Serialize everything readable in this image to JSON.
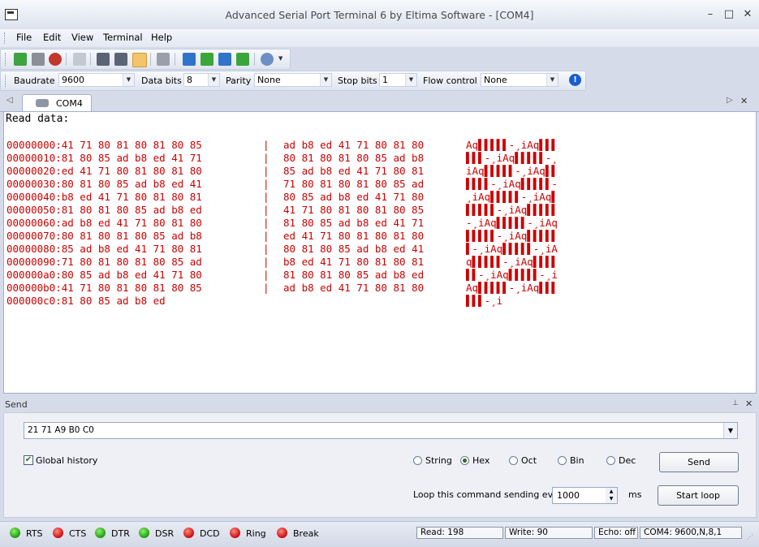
{
  "window": {
    "title": "Advanced Serial Port Terminal 6 by Eltima Software - [COM4]",
    "minimize": "–",
    "maximize": "□",
    "close": "✕"
  },
  "menu": [
    "File",
    "Edit",
    "View",
    "Terminal",
    "Help"
  ],
  "params": {
    "baudrate_label": "Baudrate",
    "baudrate_value": "9600",
    "databits_label": "Data bits",
    "databits_value": "8",
    "parity_label": "Parity",
    "parity_value": "None",
    "stopbits_label": "Stop bits",
    "stopbits_value": "1",
    "flow_label": "Flow control",
    "flow_value": "None"
  },
  "tab": {
    "label": "COM4",
    "close": "✕",
    "left_arrow": "◁",
    "right_arrow": "▷"
  },
  "terminal": {
    "header": "Read data:",
    "lines": [
      {
        "addr": "00000000:",
        "h1": "41 71 80 81 80 81 80 85",
        "h2": "ad b8 ed 41 71 80 81 80",
        "ascii": "Aq▌▌▌▌▌-¸iAq▌▌▌"
      },
      {
        "addr": "00000010:",
        "h1": "81 80 85 ad b8 ed 41 71",
        "h2": "80 81 80 81 80 85 ad b8",
        "ascii": "▌▌▌-¸iAq▌▌▌▌▌-¸"
      },
      {
        "addr": "00000020:",
        "h1": "ed 41 71 80 81 80 81 80",
        "h2": "85 ad b8 ed 41 71 80 81",
        "ascii": "iAq▌▌▌▌▌-¸iAq▌▌"
      },
      {
        "addr": "00000030:",
        "h1": "80 81 80 85 ad b8 ed 41",
        "h2": "71 80 81 80 81 80 85 ad",
        "ascii": "▌▌▌▌-¸iAq▌▌▌▌▌-"
      },
      {
        "addr": "00000040:",
        "h1": "b8 ed 41 71 80 81 80 81",
        "h2": "80 85 ad b8 ed 41 71 80",
        "ascii": "¸iAq▌▌▌▌▌-¸iAq▌"
      },
      {
        "addr": "00000050:",
        "h1": "81 80 81 80 85 ad b8 ed",
        "h2": "41 71 80 81 80 81 80 85",
        "ascii": "▌▌▌▌▌-¸iAq▌▌▌▌▌"
      },
      {
        "addr": "00000060:",
        "h1": "ad b8 ed 41 71 80 81 80",
        "h2": "81 80 85 ad b8 ed 41 71",
        "ascii": "-¸iAq▌▌▌▌▌-¸iAq"
      },
      {
        "addr": "00000070:",
        "h1": "80 81 80 81 80 85 ad b8",
        "h2": "ed 41 71 80 81 80 81 80",
        "ascii": "▌▌▌▌▌-¸iAq▌▌▌▌▌"
      },
      {
        "addr": "00000080:",
        "h1": "85 ad b8 ed 41 71 80 81",
        "h2": "80 81 80 85 ad b8 ed 41",
        "ascii": "▌-¸iAq▌▌▌▌▌-¸iA"
      },
      {
        "addr": "00000090:",
        "h1": "71 80 81 80 81 80 85 ad",
        "h2": "b8 ed 41 71 80 81 80 81",
        "ascii": "q▌▌▌▌▌-¸iAq▌▌▌▌"
      },
      {
        "addr": "000000a0:",
        "h1": "80 85 ad b8 ed 41 71 80",
        "h2": "81 80 81 80 85 ad b8 ed",
        "ascii": "▌▌-¸iAq▌▌▌▌▌-¸i"
      },
      {
        "addr": "000000b0:",
        "h1": "41 71 80 81 80 81 80 85",
        "h2": "ad b8 ed 41 71 80 81 80",
        "ascii": "Aq▌▌▌▌▌-¸iAq▌▌▌"
      },
      {
        "addr": "000000c0:",
        "h1": "81 80 85 ad b8 ed",
        "h2": "",
        "ascii": "▌▌▌-¸i"
      }
    ],
    "separator": "|"
  },
  "send": {
    "title": "Send",
    "pin": "📌",
    "close": "✕",
    "input_value": "21 71 A9 B0 C0",
    "global_history_label": "Global history",
    "global_history_checked": true,
    "modes": [
      {
        "label": "String",
        "selected": false
      },
      {
        "label": "Hex",
        "selected": true
      },
      {
        "label": "Oct",
        "selected": false
      },
      {
        "label": "Bin",
        "selected": false
      },
      {
        "label": "Dec",
        "selected": false
      }
    ],
    "send_button": "Send",
    "loop_label": "Loop this command sending every",
    "loop_value": "1000",
    "loop_unit": "ms",
    "start_loop_button": "Start loop"
  },
  "status": {
    "signals": [
      {
        "label": "RTS",
        "color": "green"
      },
      {
        "label": "CTS",
        "color": "red"
      },
      {
        "label": "DTR",
        "color": "green"
      },
      {
        "label": "DSR",
        "color": "green"
      },
      {
        "label": "DCD",
        "color": "red"
      },
      {
        "label": "Ring",
        "color": "red"
      },
      {
        "label": "Break",
        "color": "red"
      }
    ],
    "read": "Read: 198",
    "write": "Write: 90",
    "echo": "Echo: off",
    "port": "COM4: 9600,N,8,1"
  },
  "colors": {
    "terminal_text": "#cc0000",
    "accent": "#1a5fd0"
  }
}
